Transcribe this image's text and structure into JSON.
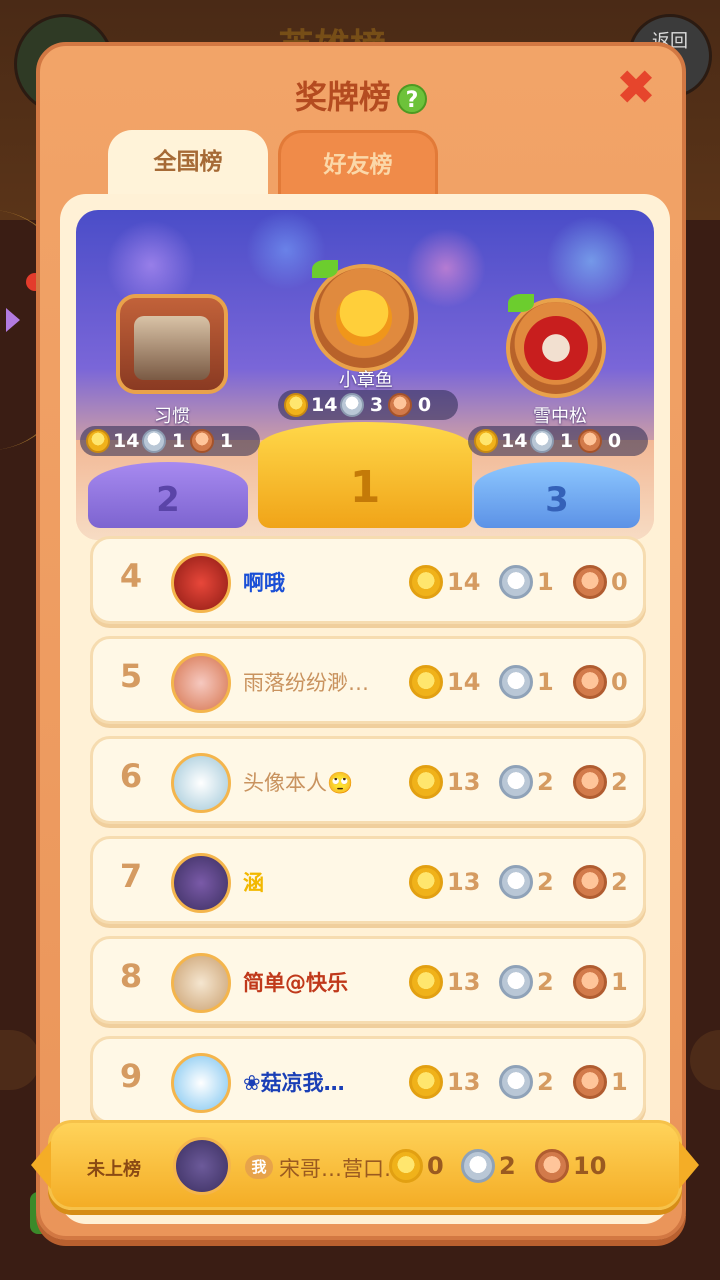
{
  "background": {
    "ghost_title": "英雄榜",
    "back_label": "返回"
  },
  "dialog": {
    "title": "奖牌榜",
    "tabs": [
      {
        "label": "全国榜",
        "active": true
      },
      {
        "label": "好友榜",
        "active": false
      }
    ]
  },
  "podium": [
    {
      "rank": 1,
      "name": "小章鱼",
      "gold": 14,
      "silver": 3,
      "bronze": 0
    },
    {
      "rank": 2,
      "name": "习惯",
      "gold": 14,
      "silver": 1,
      "bronze": 1
    },
    {
      "rank": 3,
      "name": "雪中松",
      "gold": 14,
      "silver": 1,
      "bronze": 0
    }
  ],
  "podium_numbers": [
    "1",
    "2",
    "3"
  ],
  "rows": [
    {
      "rank": "4",
      "name": "啊哦",
      "gold": 14,
      "silver": 1,
      "bronze": 0,
      "name_color": "#1a4fd6"
    },
    {
      "rank": "5",
      "name": "雨落纷纷渺…",
      "gold": 14,
      "silver": 1,
      "bronze": 0,
      "name_color": "#c9935f"
    },
    {
      "rank": "6",
      "name": "头像本人🙄",
      "gold": 13,
      "silver": 2,
      "bronze": 2,
      "name_color": "#c9935f"
    },
    {
      "rank": "7",
      "name": "涵",
      "gold": 13,
      "silver": 2,
      "bronze": 2,
      "name_color": "#f2b800"
    },
    {
      "rank": "8",
      "name": "简单@快乐",
      "gold": 13,
      "silver": 2,
      "bronze": 1,
      "name_color": "#c0391b"
    },
    {
      "rank": "9",
      "name": "❀菇凉我…",
      "gold": 13,
      "silver": 2,
      "bronze": 1,
      "name_color": "#1a3fb6"
    }
  ],
  "self": {
    "status_label": "未上榜",
    "me_tag": "我",
    "name": "宋哥…营口…",
    "gold": 0,
    "silver": 2,
    "bronze": 10
  },
  "colors": {
    "panel": "#ef9e62",
    "content_bg": "#fff1d6",
    "rank_text": "#d59b61",
    "title_text": "#b44b20"
  }
}
